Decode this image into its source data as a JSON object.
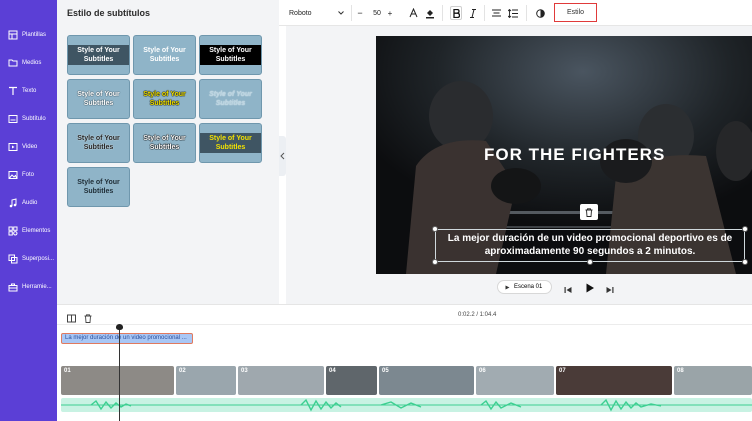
{
  "nav": {
    "items": [
      {
        "label": "Plantillas",
        "icon": "template-icon"
      },
      {
        "label": "Medios",
        "icon": "folder-icon"
      },
      {
        "label": "Texto",
        "icon": "text-icon"
      },
      {
        "label": "Subtítulo",
        "icon": "subtitle-icon"
      },
      {
        "label": "Video",
        "icon": "video-icon"
      },
      {
        "label": "Foto",
        "icon": "photo-icon"
      },
      {
        "label": "Audio",
        "icon": "music-icon"
      },
      {
        "label": "Elementos",
        "icon": "elements-icon"
      },
      {
        "label": "Superposi...",
        "icon": "overlay-icon"
      },
      {
        "label": "Herramie...",
        "icon": "toolbox-icon"
      }
    ]
  },
  "panel": {
    "title": "Estilo de subtítulos",
    "tiles": [
      {
        "text": "Style of Your Subtitles",
        "variant": "dark-box"
      },
      {
        "text": "Style of Your Subtitles",
        "variant": "plain-white"
      },
      {
        "text": "Style of Your Subtitles",
        "variant": "black-box"
      },
      {
        "text": "Style of Your Subtitles",
        "variant": "outline-white"
      },
      {
        "text": "Style of Your Subtitles",
        "variant": "yellow-outline"
      },
      {
        "text": "Style of Your Subtitles",
        "variant": "ghost-italic"
      },
      {
        "text": "Style of Your Subtitles",
        "variant": "black-outline"
      },
      {
        "text": "Style of Your Subtitles",
        "variant": "white-bold-outline"
      },
      {
        "text": "Style of Your Subtitles",
        "variant": "yellow-on-dark"
      },
      {
        "text": "Style of Your Subtitles",
        "variant": "dark-plain"
      }
    ]
  },
  "toolbar": {
    "font": "Roboto",
    "font_size": "50",
    "minus": "−",
    "plus": "+",
    "style_button": "Estilo"
  },
  "canvas": {
    "headline": "FOR THE FIGHTERS",
    "subtitle": "La mejor duración de un video promocional deportivo es de aproximadamente 90 segundos a 2 minutos.",
    "scene_label": "Escena 01"
  },
  "timeline": {
    "time": "0:02.2 / 1:04.4",
    "subtitle_clip": "La mejor duración de un video promocional ...",
    "scenes": [
      "01",
      "02",
      "03",
      "04",
      "05",
      "06",
      "07",
      "08"
    ]
  },
  "colors": {
    "nav_bg": "#5b3fd6",
    "tile_bg": "#8fb4c8",
    "style_button_border": "#e03a3a",
    "audio_wave": "#3ccf91"
  }
}
